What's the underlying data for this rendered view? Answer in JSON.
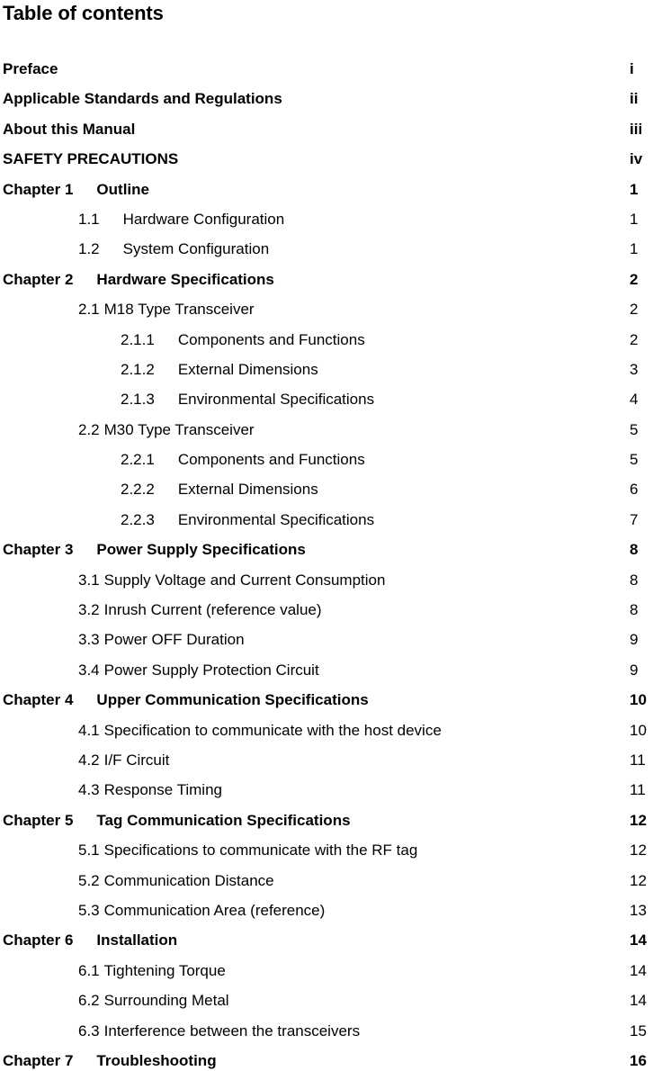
{
  "document": {
    "title": "Table of contents"
  },
  "toc": {
    "entries": [
      {
        "number": "",
        "title": "Preface",
        "page": "i",
        "level": 0,
        "bold": true,
        "gap": "none"
      },
      {
        "number": "",
        "title": "Applicable Standards and Regulations",
        "page": "ii",
        "level": 0,
        "bold": true,
        "gap": "none"
      },
      {
        "number": "",
        "title": "About this Manual",
        "page": "iii",
        "level": 0,
        "bold": true,
        "gap": "none"
      },
      {
        "number": "",
        "title": "SAFETY PRECAUTIONS",
        "page": "iv",
        "level": 0,
        "bold": true,
        "gap": "none"
      },
      {
        "number": "Chapter 1",
        "title": "Outline",
        "page": "1",
        "level": 0,
        "bold": true,
        "gap": "wide"
      },
      {
        "number": "1.1",
        "title": "Hardware Configuration",
        "page": "1",
        "level": 1,
        "bold": false,
        "gap": "wide"
      },
      {
        "number": "1.2",
        "title": "System Configuration",
        "page": "1",
        "level": 1,
        "bold": false,
        "gap": "wide"
      },
      {
        "number": "Chapter 2",
        "title": "Hardware Specifications",
        "page": "2",
        "level": 0,
        "bold": true,
        "gap": "wide"
      },
      {
        "number": "2.1",
        "title": "M18 Type Transceiver",
        "page": "2",
        "level": 1,
        "bold": false,
        "gap": "narrow"
      },
      {
        "number": "2.1.1",
        "title": "Components and Functions",
        "page": "2",
        "level": 2,
        "bold": false,
        "gap": "wide"
      },
      {
        "number": "2.1.2",
        "title": "External Dimensions",
        "page": "3",
        "level": 2,
        "bold": false,
        "gap": "wide"
      },
      {
        "number": "2.1.3",
        "title": "Environmental Specifications",
        "page": "4",
        "level": 2,
        "bold": false,
        "gap": "wide"
      },
      {
        "number": "2.2",
        "title": "M30 Type Transceiver",
        "page": "5",
        "level": 1,
        "bold": false,
        "gap": "narrow"
      },
      {
        "number": "2.2.1",
        "title": "Components and Functions",
        "page": "5",
        "level": 2,
        "bold": false,
        "gap": "wide"
      },
      {
        "number": "2.2.2",
        "title": "External Dimensions",
        "page": "6",
        "level": 2,
        "bold": false,
        "gap": "wide"
      },
      {
        "number": "2.2.3",
        "title": "Environmental Specifications",
        "page": "7",
        "level": 2,
        "bold": false,
        "gap": "wide"
      },
      {
        "number": "Chapter 3",
        "title": "Power Supply Specifications",
        "page": "8",
        "level": 0,
        "bold": true,
        "gap": "wide"
      },
      {
        "number": "3.1",
        "title": "Supply Voltage and Current Consumption",
        "page": "8",
        "level": 1,
        "bold": false,
        "gap": "narrow"
      },
      {
        "number": "3.2",
        "title": "Inrush Current (reference value)",
        "page": "8",
        "level": 1,
        "bold": false,
        "gap": "narrow"
      },
      {
        "number": "3.3",
        "title": "Power OFF Duration",
        "page": "9",
        "level": 1,
        "bold": false,
        "gap": "narrow"
      },
      {
        "number": "3.4",
        "title": "Power Supply Protection Circuit",
        "page": "9",
        "level": 1,
        "bold": false,
        "gap": "narrow"
      },
      {
        "number": "Chapter 4",
        "title": "Upper Communication Specifications",
        "page": "10",
        "level": 0,
        "bold": true,
        "gap": "wide"
      },
      {
        "number": "4.1",
        "title": "Specification to communicate with the host device",
        "page": "10",
        "level": 1,
        "bold": false,
        "gap": "narrow"
      },
      {
        "number": "4.2",
        "title": "I/F Circuit",
        "page": "11",
        "level": 1,
        "bold": false,
        "gap": "narrow"
      },
      {
        "number": "4.3",
        "title": "Response Timing",
        "page": "11",
        "level": 1,
        "bold": false,
        "gap": "narrow"
      },
      {
        "number": "Chapter 5",
        "title": "Tag Communication Specifications",
        "page": "12",
        "level": 0,
        "bold": true,
        "gap": "wide"
      },
      {
        "number": "5.1",
        "title": "Specifications to communicate with the RF tag",
        "page": "12",
        "level": 1,
        "bold": false,
        "gap": "narrow"
      },
      {
        "number": "5.2",
        "title": "Communication Distance",
        "page": "12",
        "level": 1,
        "bold": false,
        "gap": "narrow"
      },
      {
        "number": "5.3",
        "title": "Communication Area (reference)",
        "page": "13",
        "level": 1,
        "bold": false,
        "gap": "narrow"
      },
      {
        "number": "Chapter 6",
        "title": "Installation",
        "page": "14",
        "level": 0,
        "bold": true,
        "gap": "wide"
      },
      {
        "number": "6.1",
        "title": "Tightening Torque",
        "page": "14",
        "level": 1,
        "bold": false,
        "gap": "narrow"
      },
      {
        "number": "6.2",
        "title": "Surrounding Metal",
        "page": "14",
        "level": 1,
        "bold": false,
        "gap": "narrow"
      },
      {
        "number": "6.3",
        "title": "Interference between the transceivers",
        "page": "15",
        "level": 1,
        "bold": false,
        "gap": "narrow"
      },
      {
        "number": "Chapter 7",
        "title": "Troubleshooting",
        "page": "16",
        "level": 0,
        "bold": true,
        "gap": "wide"
      }
    ]
  }
}
